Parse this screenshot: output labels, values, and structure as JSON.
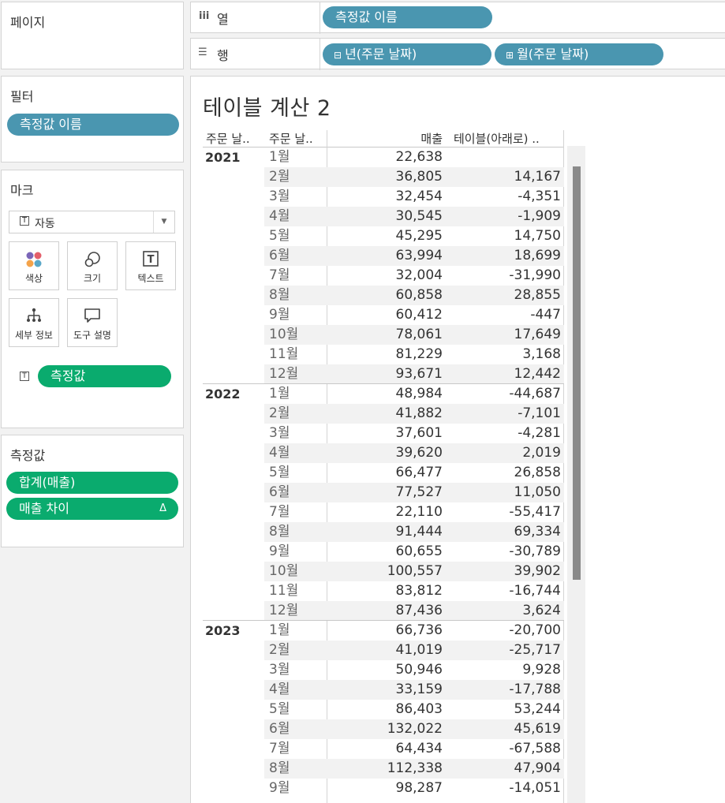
{
  "pages_panel": {
    "title": "페이지"
  },
  "columns_shelf": {
    "label": "열",
    "icon": "columns-icon",
    "pills": [
      "측정값 이름"
    ]
  },
  "rows_shelf": {
    "label": "행",
    "icon": "rows-icon",
    "pills": [
      "년(주문 날짜)",
      "월(주문 날짜)"
    ]
  },
  "filters_panel": {
    "title": "필터",
    "pills": [
      "측정값 이름"
    ]
  },
  "marks_panel": {
    "title": "마크",
    "mark_type": "자동",
    "buttons": [
      {
        "label": "색상",
        "icon": "color-icon"
      },
      {
        "label": "크기",
        "icon": "size-icon"
      },
      {
        "label": "텍스트",
        "icon": "text-icon"
      },
      {
        "label": "세부 정보",
        "icon": "detail-icon"
      },
      {
        "label": "도구 설명",
        "icon": "tooltip-icon"
      }
    ],
    "text_pill": "측정값"
  },
  "measure_values_panel": {
    "title": "측정값",
    "pills": [
      "합계(매출)",
      "매출 차이"
    ],
    "delta_symbol": "Δ"
  },
  "view": {
    "title": "테이블 계산 2",
    "headers": [
      "주문 날..",
      "주문 날..",
      "매출",
      "테이블(아래로) .."
    ],
    "groups": [
      {
        "year": "2021",
        "rows": [
          [
            "1월",
            "22,638",
            ""
          ],
          [
            "2월",
            "36,805",
            "14,167"
          ],
          [
            "3월",
            "32,454",
            "-4,351"
          ],
          [
            "4월",
            "30,545",
            "-1,909"
          ],
          [
            "5월",
            "45,295",
            "14,750"
          ],
          [
            "6월",
            "63,994",
            "18,699"
          ],
          [
            "7월",
            "32,004",
            "-31,990"
          ],
          [
            "8월",
            "60,858",
            "28,855"
          ],
          [
            "9월",
            "60,412",
            "-447"
          ],
          [
            "10월",
            "78,061",
            "17,649"
          ],
          [
            "11월",
            "81,229",
            "3,168"
          ],
          [
            "12월",
            "93,671",
            "12,442"
          ]
        ]
      },
      {
        "year": "2022",
        "rows": [
          [
            "1월",
            "48,984",
            "-44,687"
          ],
          [
            "2월",
            "41,882",
            "-7,101"
          ],
          [
            "3월",
            "37,601",
            "-4,281"
          ],
          [
            "4월",
            "39,620",
            "2,019"
          ],
          [
            "5월",
            "66,477",
            "26,858"
          ],
          [
            "6월",
            "77,527",
            "11,050"
          ],
          [
            "7월",
            "22,110",
            "-55,417"
          ],
          [
            "8월",
            "91,444",
            "69,334"
          ],
          [
            "9월",
            "60,655",
            "-30,789"
          ],
          [
            "10월",
            "100,557",
            "39,902"
          ],
          [
            "11월",
            "83,812",
            "-16,744"
          ],
          [
            "12월",
            "87,436",
            "3,624"
          ]
        ]
      },
      {
        "year": "2023",
        "rows": [
          [
            "1월",
            "66,736",
            "-20,700"
          ],
          [
            "2월",
            "41,019",
            "-25,717"
          ],
          [
            "3월",
            "50,946",
            "9,928"
          ],
          [
            "4월",
            "33,159",
            "-17,788"
          ],
          [
            "5월",
            "86,403",
            "53,244"
          ],
          [
            "6월",
            "132,022",
            "45,619"
          ],
          [
            "7월",
            "64,434",
            "-67,588"
          ],
          [
            "8월",
            "112,338",
            "47,904"
          ],
          [
            "9월",
            "98,287",
            "-14,051"
          ]
        ]
      }
    ]
  },
  "colors": {
    "blue_pill": "#4a96b0",
    "green_pill": "#0aab6e",
    "stripe": "#f2f2f2"
  }
}
